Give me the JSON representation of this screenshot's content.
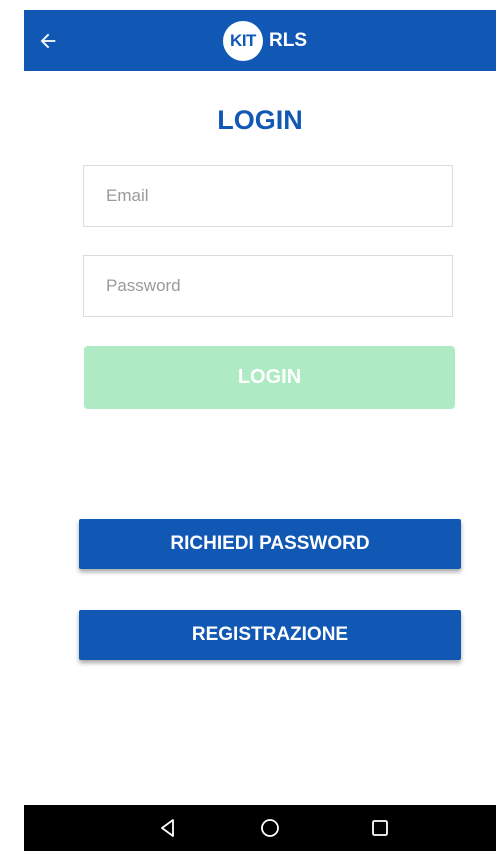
{
  "appbar": {
    "brand_badge": "KIT",
    "brand_text": "RLS",
    "back_icon": "arrow-left-icon",
    "color": "#1158b5"
  },
  "login": {
    "title": "LOGIN",
    "email_placeholder": "Email",
    "email_value": "",
    "password_placeholder": "Password",
    "password_value": "",
    "submit_label": "LOGIN",
    "submit_color": "#aeeac3"
  },
  "actions": {
    "richiedi_password_label": "RICHIEDI PASSWORD",
    "registrazione_label": "REGISTRAZIONE"
  },
  "navbar": {
    "back_icon": "triangle-back-icon",
    "home_icon": "circle-home-icon",
    "recent_icon": "square-recents-icon"
  }
}
